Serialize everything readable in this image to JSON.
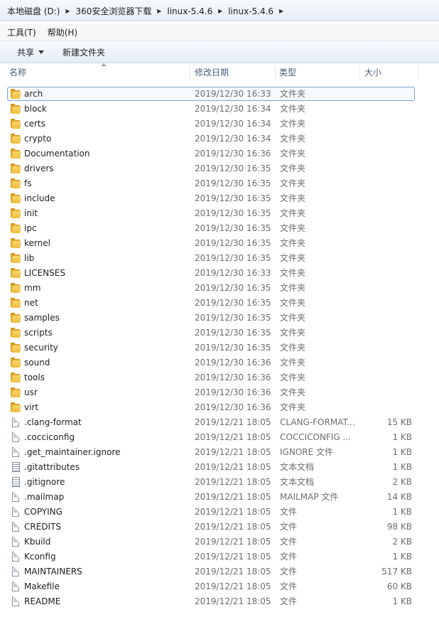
{
  "address_bar": {
    "crumbs": [
      "本地磁盘 (D:)",
      "360安全浏览器下载",
      "linux-5.4.6",
      "linux-5.4.6"
    ]
  },
  "menu": {
    "tools": "工具(T)",
    "help": "帮助(H)"
  },
  "toolbar": {
    "share_label": "共享",
    "new_folder_label": "新建文件夹"
  },
  "columns": {
    "name": "名称",
    "date": "修改日期",
    "type": "类型",
    "size": "大小"
  },
  "files": [
    {
      "name": "arch",
      "date": "2019/12/30 16:33",
      "type": "文件夹",
      "size": "",
      "icon": "folder-icon"
    },
    {
      "name": "block",
      "date": "2019/12/30 16:34",
      "type": "文件夹",
      "size": "",
      "icon": "folder-icon"
    },
    {
      "name": "certs",
      "date": "2019/12/30 16:34",
      "type": "文件夹",
      "size": "",
      "icon": "folder-icon"
    },
    {
      "name": "crypto",
      "date": "2019/12/30 16:34",
      "type": "文件夹",
      "size": "",
      "icon": "folder-icon"
    },
    {
      "name": "Documentation",
      "date": "2019/12/30 16:36",
      "type": "文件夹",
      "size": "",
      "icon": "folder-icon"
    },
    {
      "name": "drivers",
      "date": "2019/12/30 16:35",
      "type": "文件夹",
      "size": "",
      "icon": "folder-icon"
    },
    {
      "name": "fs",
      "date": "2019/12/30 16:35",
      "type": "文件夹",
      "size": "",
      "icon": "folder-icon"
    },
    {
      "name": "include",
      "date": "2019/12/30 16:35",
      "type": "文件夹",
      "size": "",
      "icon": "folder-icon"
    },
    {
      "name": "init",
      "date": "2019/12/30 16:35",
      "type": "文件夹",
      "size": "",
      "icon": "folder-icon"
    },
    {
      "name": "ipc",
      "date": "2019/12/30 16:35",
      "type": "文件夹",
      "size": "",
      "icon": "folder-icon"
    },
    {
      "name": "kernel",
      "date": "2019/12/30 16:35",
      "type": "文件夹",
      "size": "",
      "icon": "folder-icon"
    },
    {
      "name": "lib",
      "date": "2019/12/30 16:35",
      "type": "文件夹",
      "size": "",
      "icon": "folder-icon"
    },
    {
      "name": "LICENSES",
      "date": "2019/12/30 16:33",
      "type": "文件夹",
      "size": "",
      "icon": "folder-icon"
    },
    {
      "name": "mm",
      "date": "2019/12/30 16:35",
      "type": "文件夹",
      "size": "",
      "icon": "folder-icon"
    },
    {
      "name": "net",
      "date": "2019/12/30 16:35",
      "type": "文件夹",
      "size": "",
      "icon": "folder-icon"
    },
    {
      "name": "samples",
      "date": "2019/12/30 16:35",
      "type": "文件夹",
      "size": "",
      "icon": "folder-icon"
    },
    {
      "name": "scripts",
      "date": "2019/12/30 16:35",
      "type": "文件夹",
      "size": "",
      "icon": "folder-icon"
    },
    {
      "name": "security",
      "date": "2019/12/30 16:35",
      "type": "文件夹",
      "size": "",
      "icon": "folder-icon"
    },
    {
      "name": "sound",
      "date": "2019/12/30 16:36",
      "type": "文件夹",
      "size": "",
      "icon": "folder-icon"
    },
    {
      "name": "tools",
      "date": "2019/12/30 16:36",
      "type": "文件夹",
      "size": "",
      "icon": "folder-icon"
    },
    {
      "name": "usr",
      "date": "2019/12/30 16:36",
      "type": "文件夹",
      "size": "",
      "icon": "folder-icon"
    },
    {
      "name": "virt",
      "date": "2019/12/30 16:36",
      "type": "文件夹",
      "size": "",
      "icon": "folder-icon"
    },
    {
      "name": ".clang-format",
      "date": "2019/12/21 18:05",
      "type": "CLANG-FORMAT...",
      "size": "15 KB",
      "icon": "file-icon"
    },
    {
      "name": ".cocciconfig",
      "date": "2019/12/21 18:05",
      "type": "COCCICONFIG ...",
      "size": "1 KB",
      "icon": "file-icon"
    },
    {
      "name": ".get_maintainer.ignore",
      "date": "2019/12/21 18:05",
      "type": "IGNORE 文件",
      "size": "1 KB",
      "icon": "file-icon"
    },
    {
      "name": ".gitattributes",
      "date": "2019/12/21 18:05",
      "type": "文本文档",
      "size": "1 KB",
      "icon": "text-file-icon"
    },
    {
      "name": ".gitignore",
      "date": "2019/12/21 18:05",
      "type": "文本文档",
      "size": "2 KB",
      "icon": "text-file-icon"
    },
    {
      "name": ".mailmap",
      "date": "2019/12/21 18:05",
      "type": "MAILMAP 文件",
      "size": "14 KB",
      "icon": "file-icon"
    },
    {
      "name": "COPYING",
      "date": "2019/12/21 18:05",
      "type": "文件",
      "size": "1 KB",
      "icon": "file-icon"
    },
    {
      "name": "CREDITS",
      "date": "2019/12/21 18:05",
      "type": "文件",
      "size": "98 KB",
      "icon": "file-icon"
    },
    {
      "name": "Kbuild",
      "date": "2019/12/21 18:05",
      "type": "文件",
      "size": "2 KB",
      "icon": "file-icon"
    },
    {
      "name": "Kconfig",
      "date": "2019/12/21 18:05",
      "type": "文件",
      "size": "1 KB",
      "icon": "file-icon"
    },
    {
      "name": "MAINTAINERS",
      "date": "2019/12/21 18:05",
      "type": "文件",
      "size": "517 KB",
      "icon": "file-icon"
    },
    {
      "name": "Makefile",
      "date": "2019/12/21 18:05",
      "type": "文件",
      "size": "60 KB",
      "icon": "file-icon"
    },
    {
      "name": "README",
      "date": "2019/12/21 18:05",
      "type": "文件",
      "size": "1 KB",
      "icon": "file-icon"
    }
  ]
}
